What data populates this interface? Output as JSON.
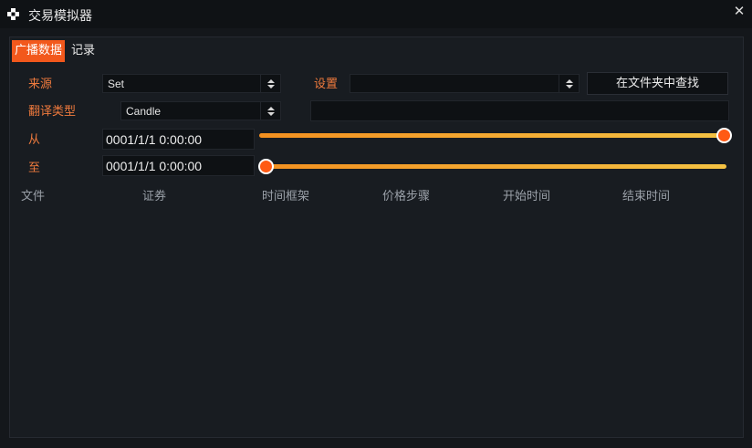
{
  "window": {
    "title": "交易模拟器",
    "icon": "checker-logo-icon",
    "close_glyph": "✕"
  },
  "tabs": [
    {
      "label": "广播数据",
      "active": true
    },
    {
      "label": "记录",
      "active": false
    }
  ],
  "form": {
    "source_label": "来源",
    "source_value": "Set",
    "settings_label": "设置",
    "settings_value": "",
    "find_in_folder_label": "在文件夹中查找",
    "translate_type_label": "翻译类型",
    "translate_type_value": "Candle",
    "extra_value": "",
    "from_label": "从",
    "from_value": "0001/1/1 0:00:00",
    "from_slider_percent": 100,
    "to_label": "至",
    "to_value": "0001/1/1 0:00:00",
    "to_slider_percent": 0
  },
  "table": {
    "columns": [
      "文件",
      "证券",
      "时间框架",
      "价格步骤",
      "开始时间",
      "结束时间"
    ],
    "rows": []
  },
  "colors": {
    "accent": "#f2581c",
    "label": "#ef7a3d",
    "slider_start": "#f39020",
    "slider_end": "#f4c243",
    "thumb": "#ff5a14"
  }
}
